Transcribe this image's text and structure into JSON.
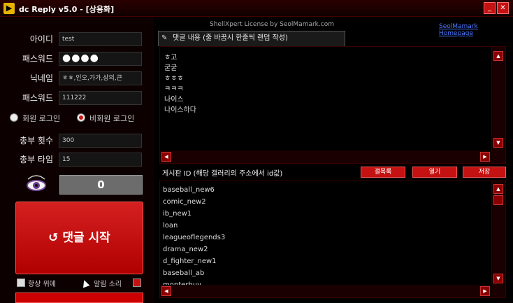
{
  "window": {
    "title": "dc Reply v5.0 - [상용화]",
    "icon": "app-logo-icon",
    "minimize_label": "_",
    "close_label": "✕"
  },
  "left_panel": {
    "fields": [
      {
        "label": "아이디",
        "value": "test"
      },
      {
        "label": "패스워드",
        "value": "●●●●"
      },
      {
        "label": "닉네임",
        "value": "ㅎㅎ,인오,가가,상의,큰"
      },
      {
        "label": "패스워드",
        "value": "111222"
      }
    ],
    "login_options": [
      {
        "label": "회원 로그인",
        "selected": false
      },
      {
        "label": "비회원 로그인",
        "selected": true
      }
    ],
    "repeat_count": {
      "label": "총부 횟수",
      "value": "300"
    },
    "repeat_delay": {
      "label": "총부 타임",
      "value": "15"
    },
    "eye_icon": "eye-icon",
    "counter_value": "0",
    "start_button": "↺ 댓글 시작",
    "checkboxes": [
      {
        "label": "항상 위에",
        "checked": false
      },
      {
        "label": "알림 소리",
        "checked": true
      }
    ]
  },
  "header": {
    "license_text": "ShellXpert License by SeolMamark.com",
    "site_link": "SeolMamark Homepage"
  },
  "comment_tab": {
    "label": "댓글 내용 (줄 바꿈시 한줄씩 랜덤 작성)",
    "lines": [
      "ㅎ고",
      "굳굳",
      "ㅎㅎㅎ",
      "ㅋㅋㅋ",
      "나이스",
      "나이스하다"
    ]
  },
  "board": {
    "label": "게시판 ID (해당 갤러리의 주소에서 id값)",
    "buttons": [
      "갤목록",
      "열기",
      "저장"
    ],
    "items": [
      "baseball_new6",
      "comic_new2",
      "ib_new1",
      "loan",
      "leagueoflegends3",
      "drama_new2",
      "d_fighter_new1",
      "baseball_ab",
      "monterbuy"
    ]
  },
  "scroll": {
    "up": "▲",
    "down": "▼",
    "left": "◀",
    "right": "▶"
  },
  "colors": {
    "accent": "#c41212",
    "background": "#000000",
    "link": "#4a78ff"
  }
}
